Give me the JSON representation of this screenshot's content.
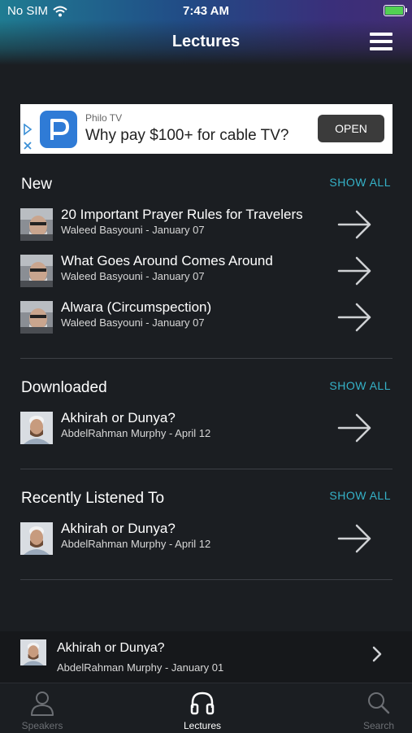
{
  "status_bar": {
    "carrier": "No SIM",
    "time": "7:43 AM"
  },
  "header": {
    "title": "Lectures"
  },
  "ad": {
    "sponsor": "Philo TV",
    "headline": "Why pay $100+ for cable TV?",
    "cta": "OPEN"
  },
  "sections": {
    "new": {
      "title": "New",
      "show_all": "SHOW ALL",
      "items": [
        {
          "title": "20 Important Prayer Rules for Travelers",
          "subtitle": "Waleed Basyouni - January 07"
        },
        {
          "title": "What Goes Around Comes Around",
          "subtitle": "Waleed Basyouni - January 07"
        },
        {
          "title": "Alwara (Circumspection)",
          "subtitle": "Waleed Basyouni - January 07"
        }
      ]
    },
    "downloaded": {
      "title": "Downloaded",
      "show_all": "SHOW ALL",
      "items": [
        {
          "title": "Akhirah or Dunya?",
          "subtitle": "AbdelRahman Murphy - April 12"
        }
      ]
    },
    "recent": {
      "title": "Recently Listened To",
      "show_all": "SHOW ALL",
      "items": [
        {
          "title": "Akhirah or Dunya?",
          "subtitle": "AbdelRahman Murphy - April 12"
        }
      ]
    }
  },
  "now_playing": {
    "title": "Akhirah or Dunya?",
    "subtitle": "AbdelRahman Murphy - January 01"
  },
  "tabs": [
    {
      "label": "Speakers",
      "icon": "person-icon",
      "active": false
    },
    {
      "label": "Lectures",
      "icon": "headphones-icon",
      "active": true
    },
    {
      "label": "Search",
      "icon": "search-icon",
      "active": false
    }
  ],
  "colors": {
    "accent": "#35b2c8",
    "background": "#1b1e22",
    "ad_logo": "#2f7bd6",
    "battery": "#52d053"
  }
}
